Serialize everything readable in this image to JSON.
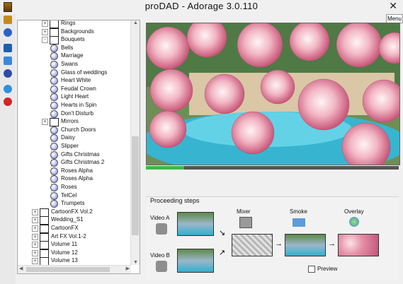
{
  "window": {
    "title": "proDAD - Adorage 3.0.110",
    "close": "✕",
    "menu_label": "Menu"
  },
  "tree": {
    "items": [
      {
        "label": "Rings",
        "icon": "folder",
        "expander": "+"
      },
      {
        "label": "Backgrounds",
        "icon": "folder",
        "expander": "+"
      },
      {
        "label": "Bouquets",
        "icon": "folder",
        "expander": "-"
      },
      {
        "label": "Bells",
        "icon": "effect"
      },
      {
        "label": "Marriage",
        "icon": "effect"
      },
      {
        "label": "Swans",
        "icon": "effect"
      },
      {
        "label": "Glass of weddings",
        "icon": "effect"
      },
      {
        "label": "Heart White",
        "icon": "effect"
      },
      {
        "label": "Feudal Crown",
        "icon": "effect"
      },
      {
        "label": "Light Heart",
        "icon": "effect"
      },
      {
        "label": "Hearts in Spin",
        "icon": "effect"
      },
      {
        "label": "Don't Disturb",
        "icon": "effect"
      },
      {
        "label": "Mirrors",
        "icon": "folder",
        "expander": "+"
      },
      {
        "label": "Church Doors",
        "icon": "effect"
      },
      {
        "label": "Daisy",
        "icon": "effect"
      },
      {
        "label": "Slipper",
        "icon": "effect"
      },
      {
        "label": "Gifts Christmas",
        "icon": "effect"
      },
      {
        "label": "Gifts Christmas 2",
        "icon": "effect"
      },
      {
        "label": "Roses Alpha",
        "icon": "effect"
      },
      {
        "label": "Roses Alpha",
        "icon": "effect"
      },
      {
        "label": "Roses",
        "icon": "effect"
      },
      {
        "label": "TelCel",
        "icon": "effect"
      },
      {
        "label": "Trumpets",
        "icon": "effect"
      },
      {
        "label": "CartoonFX Vol.2",
        "icon": "folder",
        "expander": "+"
      },
      {
        "label": "Wedding_S1",
        "icon": "folder",
        "expander": "+"
      },
      {
        "label": "CartoonFX",
        "icon": "folder",
        "expander": "+"
      },
      {
        "label": "Art FX Vol.1-2",
        "icon": "folder",
        "expander": "+"
      },
      {
        "label": "Volume 11",
        "icon": "folder",
        "expander": "+"
      },
      {
        "label": "Volume 12",
        "icon": "folder",
        "expander": "+"
      },
      {
        "label": "Volume 13",
        "icon": "folder",
        "expander": "+"
      }
    ]
  },
  "timeline": {
    "progress": 0.15
  },
  "steps": {
    "title": "Proceeding steps",
    "video_a": "Video A",
    "video_b": "Video B",
    "mixer": "Mixer",
    "smoke": "Smoke",
    "overlay": "Overlay",
    "preview_label": "Preview",
    "preview_checked": false
  }
}
